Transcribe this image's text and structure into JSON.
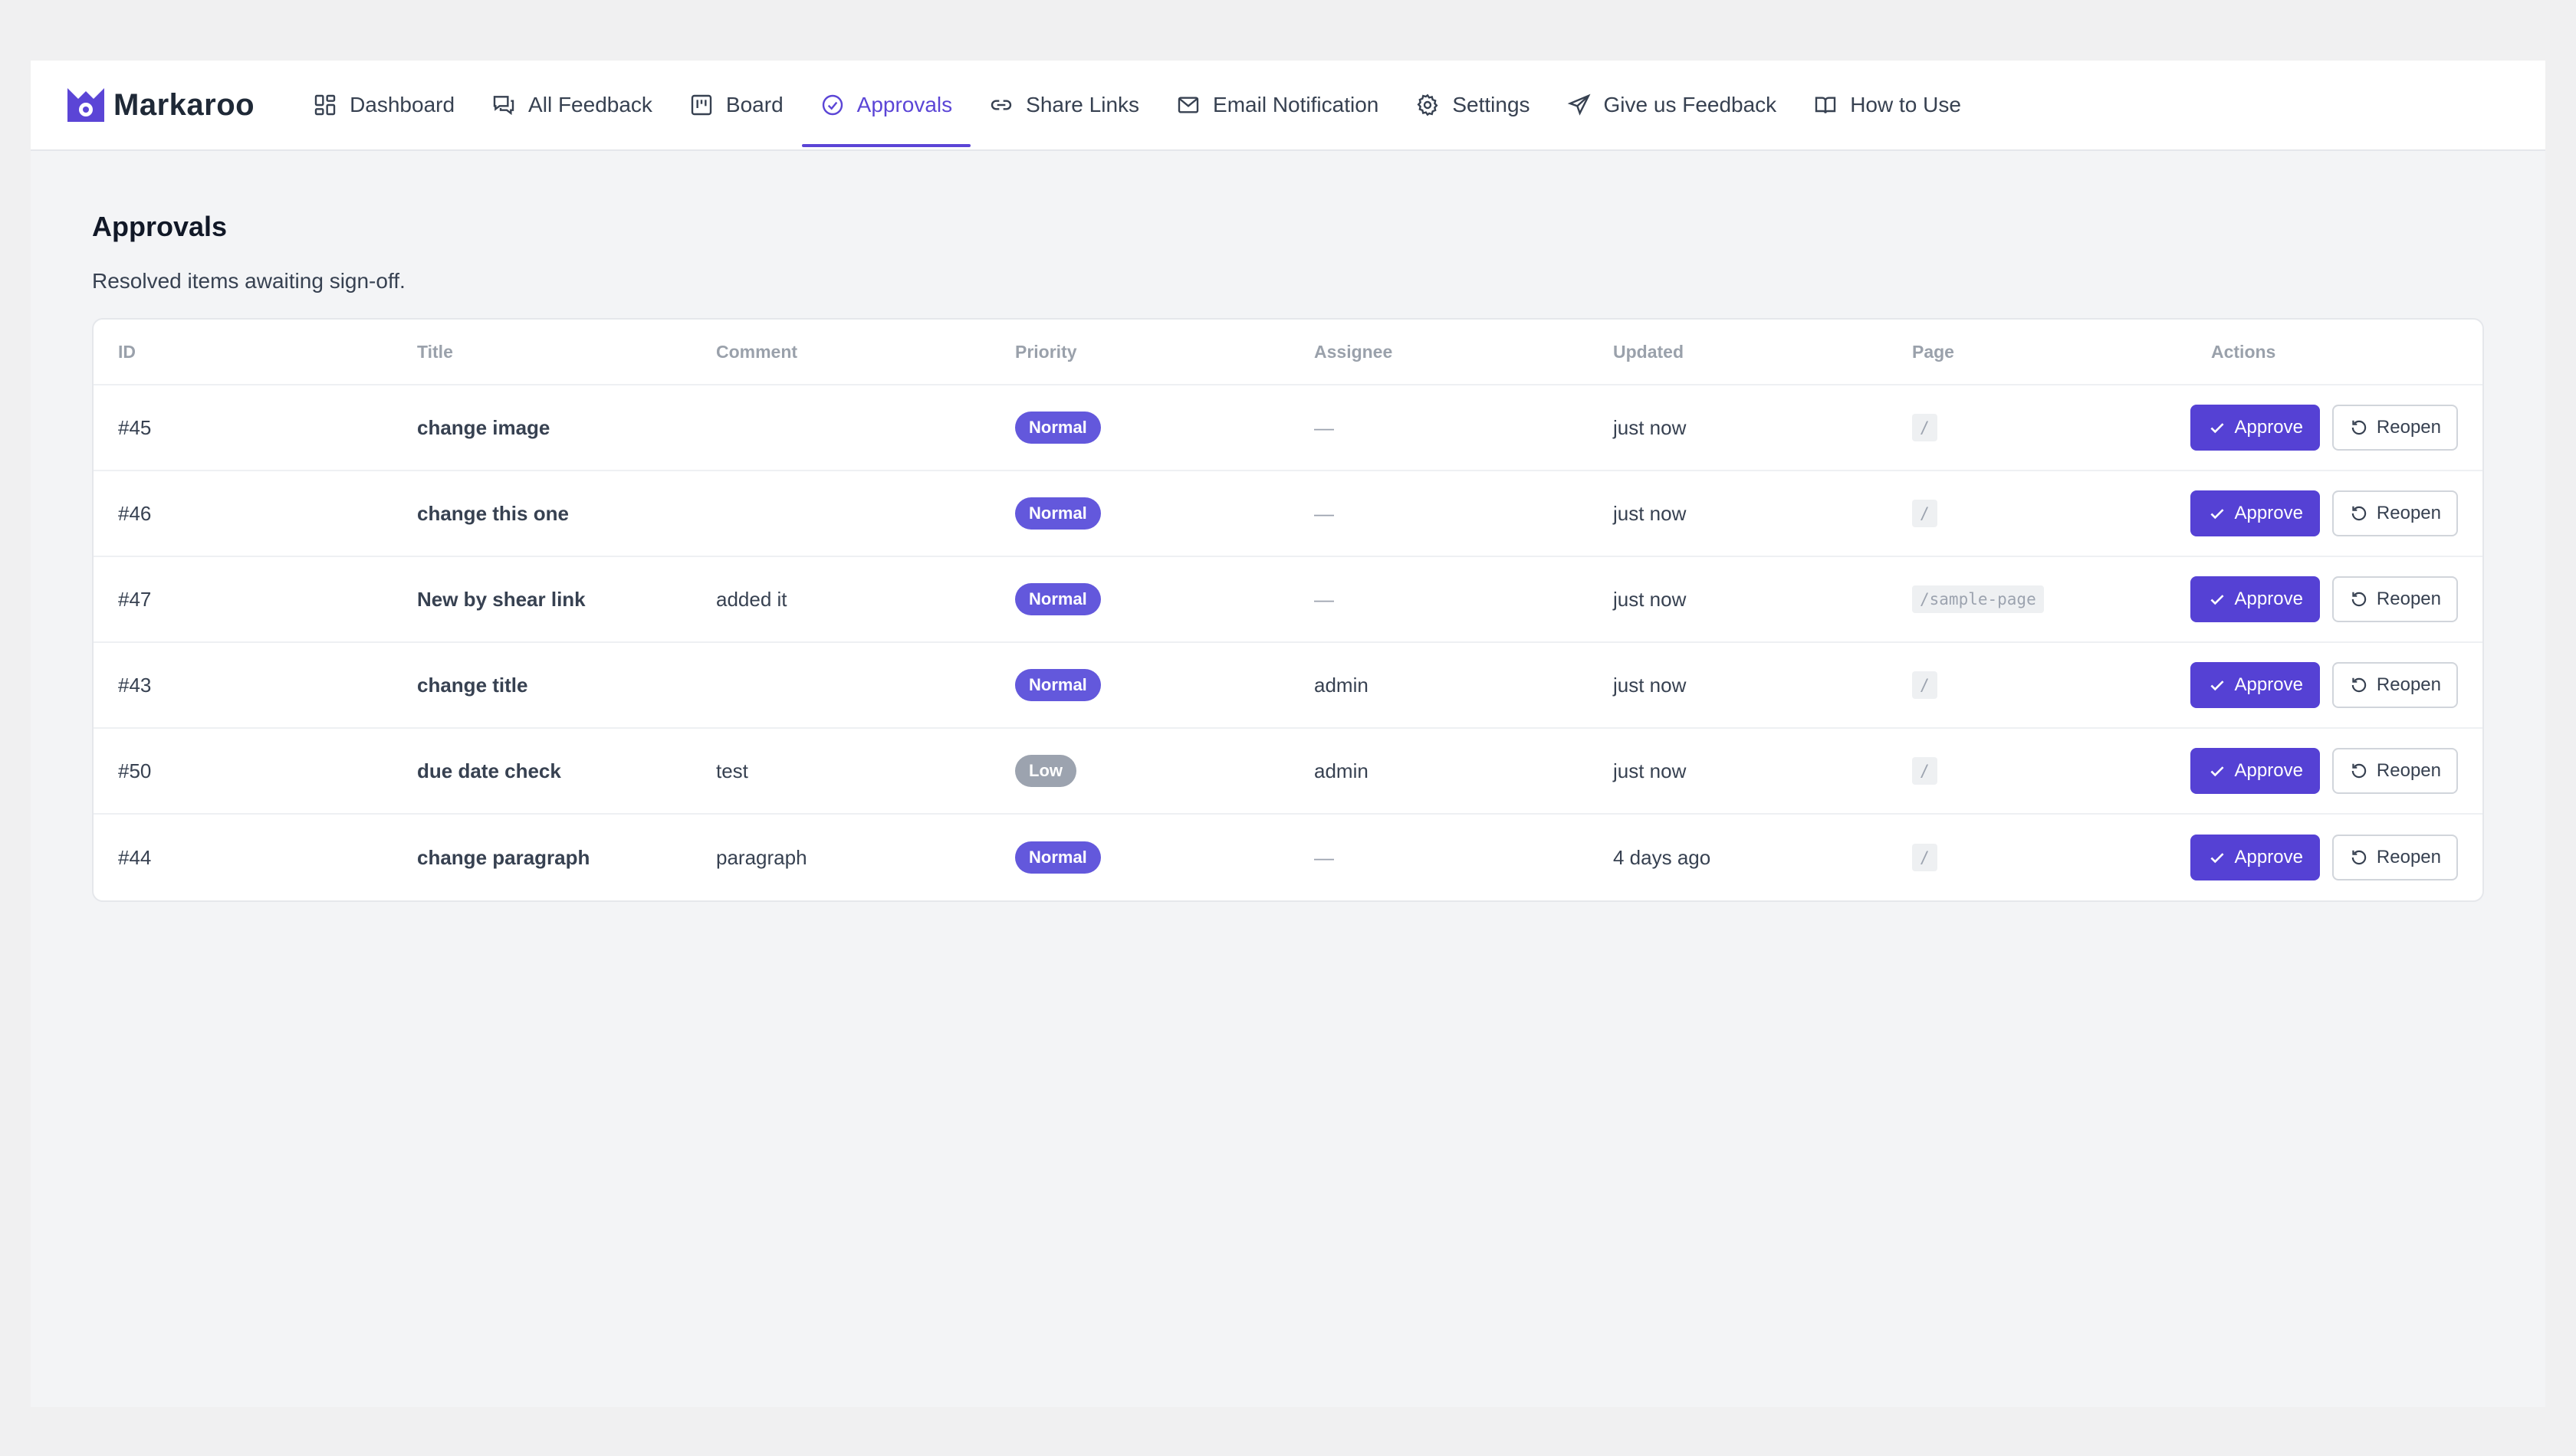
{
  "brand": {
    "name": "Markaroo"
  },
  "nav": [
    {
      "label": "Dashboard",
      "icon": "dashboard-icon"
    },
    {
      "label": "All Feedback",
      "icon": "chat-bubbles-icon"
    },
    {
      "label": "Board",
      "icon": "board-icon"
    },
    {
      "label": "Approvals",
      "icon": "check-circle-icon",
      "active": true
    },
    {
      "label": "Share Links",
      "icon": "link-icon"
    },
    {
      "label": "Email Notification",
      "icon": "envelope-icon"
    },
    {
      "label": "Settings",
      "icon": "gear-icon"
    },
    {
      "label": "Give us Feedback",
      "icon": "paper-plane-icon"
    },
    {
      "label": "How to Use",
      "icon": "book-icon"
    }
  ],
  "page": {
    "title": "Approvals",
    "subtitle": "Resolved items awaiting sign-off."
  },
  "table": {
    "headers": {
      "id": "ID",
      "title": "Title",
      "comment": "Comment",
      "priority": "Priority",
      "assignee": "Assignee",
      "updated": "Updated",
      "page": "Page",
      "actions": "Actions"
    },
    "approve_label": "Approve",
    "reopen_label": "Reopen",
    "rows": [
      {
        "id": "#45",
        "title": "change image",
        "comment": "",
        "priority": "Normal",
        "assignee": "—",
        "updated": "just now",
        "page": "/"
      },
      {
        "id": "#46",
        "title": "change this one",
        "comment": "",
        "priority": "Normal",
        "assignee": "—",
        "updated": "just now",
        "page": "/"
      },
      {
        "id": "#47",
        "title": "New by shear link",
        "comment": "added it",
        "priority": "Normal",
        "assignee": "—",
        "updated": "just now",
        "page": "/sample-page"
      },
      {
        "id": "#43",
        "title": "change title",
        "comment": "",
        "priority": "Normal",
        "assignee": "admin",
        "updated": "just now",
        "page": "/"
      },
      {
        "id": "#50",
        "title": "due date check",
        "comment": "test",
        "priority": "Low",
        "assignee": "admin",
        "updated": "just now",
        "page": "/"
      },
      {
        "id": "#44",
        "title": "change paragraph",
        "comment": "paragraph",
        "priority": "Normal",
        "assignee": "—",
        "updated": "4 days ago",
        "page": "/"
      }
    ]
  },
  "colors": {
    "accent": "#5b45d6",
    "approve_button": "#5541d4",
    "badge_normal": "#6358dc",
    "badge_low": "#9ca3af"
  }
}
